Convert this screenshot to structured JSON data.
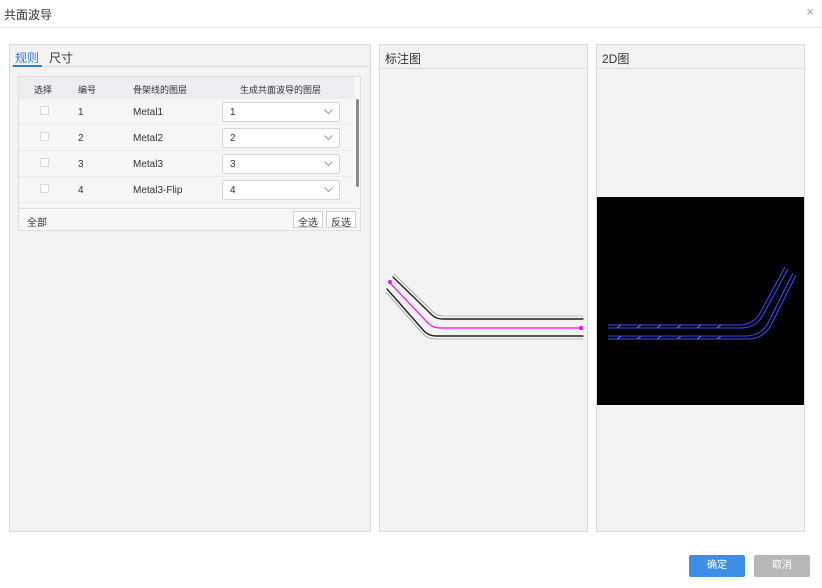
{
  "dialog": {
    "title": "共面波导",
    "close_glyph": "×"
  },
  "tabs": [
    {
      "label": "规则",
      "active": true
    },
    {
      "label": "尺寸",
      "active": false
    }
  ],
  "table": {
    "headers": [
      "选择",
      "编号",
      "骨架线的图层",
      "生成共面波导的图层"
    ],
    "rows": [
      {
        "checked": false,
        "num": "1",
        "layer": "Metal1",
        "target": "1"
      },
      {
        "checked": false,
        "num": "2",
        "layer": "Metal2",
        "target": "2"
      },
      {
        "checked": false,
        "num": "3",
        "layer": "Metal3",
        "target": "3"
      },
      {
        "checked": false,
        "num": "4",
        "layer": "Metal3-Flip",
        "target": "4"
      }
    ],
    "footer": {
      "all_label": "全部",
      "select_all": "全选",
      "invert": "反选"
    }
  },
  "annotation_panel": {
    "title": "标注图"
  },
  "view2d_panel": {
    "title": "2D图"
  },
  "footer": {
    "ok_label": "确定",
    "cancel_label": "取消"
  },
  "colors": {
    "accent": "#3d8ee6",
    "annotation_path": "#ff00ff",
    "wg_2d": "#3a4cff",
    "canvas_2d": "#000000"
  }
}
